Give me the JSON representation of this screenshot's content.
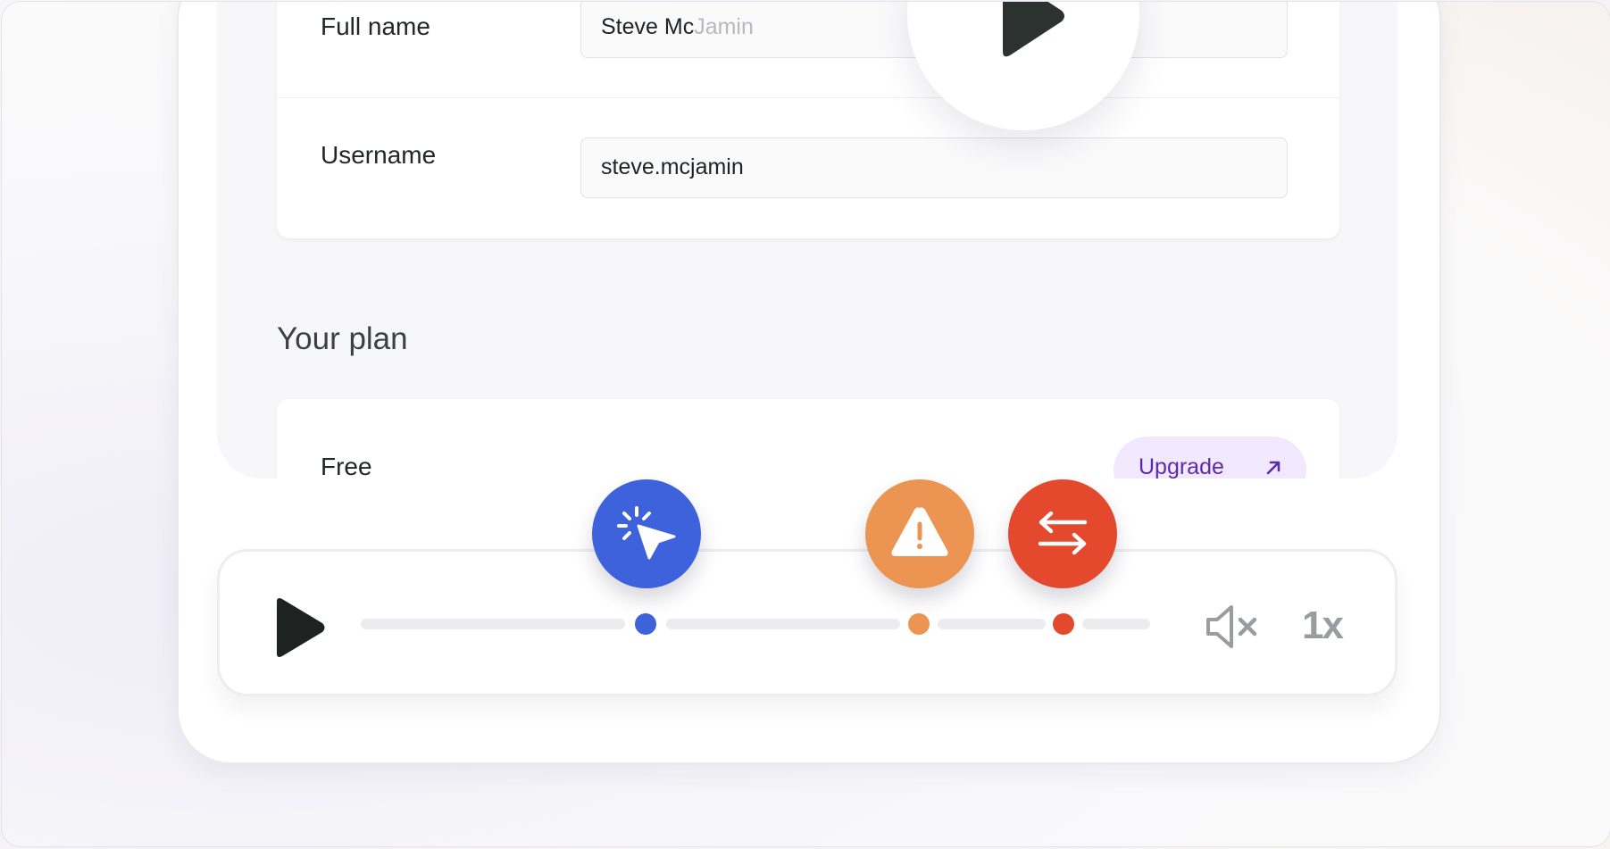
{
  "form": {
    "full_name_label": "Full name",
    "full_name_value_typed": "Steve Mc",
    "full_name_value_ghost": "Jamin",
    "username_label": "Username",
    "username_value": "steve.mcjamin"
  },
  "plan": {
    "section_title": "Your plan",
    "plan_name": "Free",
    "upgrade_label": "Upgrade"
  },
  "player": {
    "speed_label": "1x",
    "events": [
      {
        "type": "click",
        "icon": "cursor-click-icon",
        "color": "#3d62dc"
      },
      {
        "type": "warning",
        "icon": "warning-icon",
        "color": "#ec9452"
      },
      {
        "type": "navigation",
        "icon": "swap-arrows-icon",
        "color": "#e4492e"
      }
    ]
  }
}
